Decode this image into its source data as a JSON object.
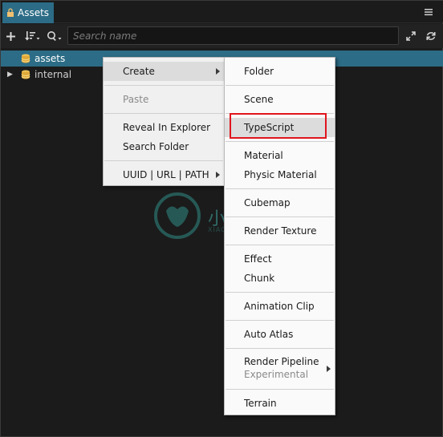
{
  "panel": {
    "tab_label": "Assets",
    "menu_icon": "hamburger-icon"
  },
  "toolbar": {
    "add_icon": "plus-icon",
    "sort_icon": "sort-icon",
    "search_type_icon": "search-icon",
    "search_placeholder": "Search name",
    "collapse_icon": "collapse-icon",
    "refresh_icon": "refresh-icon"
  },
  "tree": {
    "items": [
      {
        "label": "assets",
        "selected": true
      },
      {
        "label": "internal",
        "selected": false
      }
    ]
  },
  "context_menu": {
    "create": "Create",
    "paste": "Paste",
    "reveal": "Reveal In Explorer",
    "search_folder": "Search Folder",
    "uuid": "UUID | URL | PATH"
  },
  "create_submenu": {
    "folder": "Folder",
    "scene": "Scene",
    "typescript": "TypeScript",
    "material": "Material",
    "physic_material": "Physic Material",
    "cubemap": "Cubemap",
    "render_texture": "Render Texture",
    "effect": "Effect",
    "chunk": "Chunk",
    "animation_clip": "Animation Clip",
    "auto_atlas": "Auto Atlas",
    "render_pipeline": "Render Pipeline",
    "render_pipeline_sub": "Experimental",
    "terrain": "Terrain"
  },
  "watermark": {
    "text": "小牛知识库",
    "sub": "XIAO NIU ZHI SHI KU"
  },
  "colors": {
    "accent": "#2c6c86",
    "highlight_border": "#e0141e",
    "menu_bg": "#f0f0f0"
  }
}
